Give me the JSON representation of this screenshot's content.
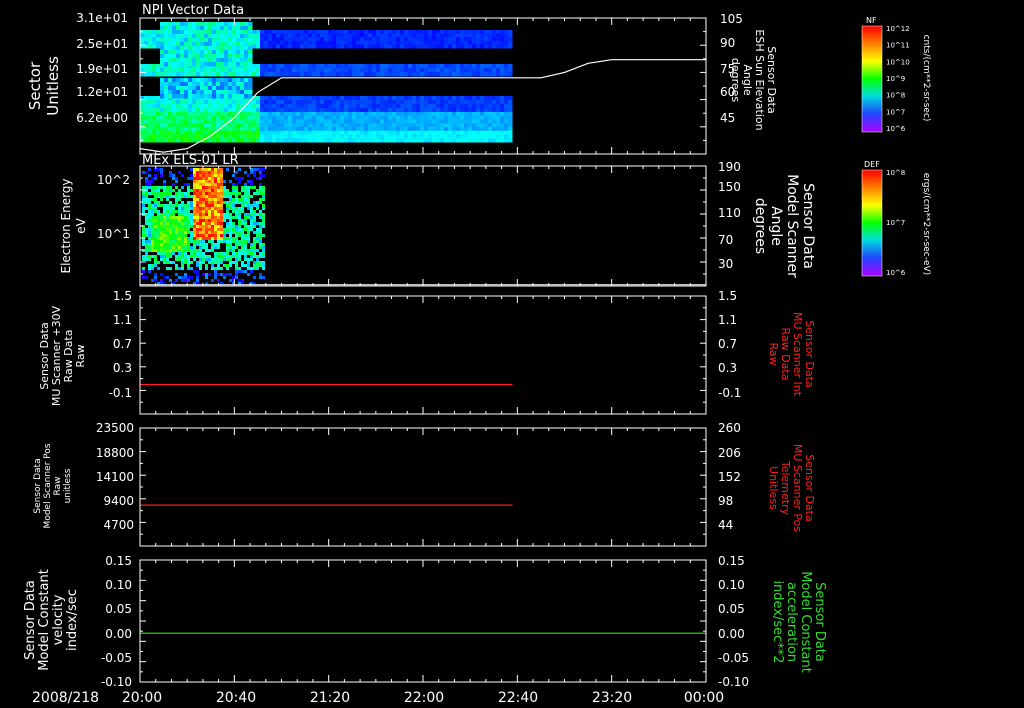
{
  "time_axis": {
    "date_label": "2008/218",
    "ticks": [
      "20:00",
      "20:40",
      "21:20",
      "22:00",
      "22:40",
      "23:20",
      "00:00"
    ],
    "range_hours": [
      20,
      24
    ]
  },
  "colors": {
    "background": "#000000",
    "axis": "#ffffff",
    "red_series": "#ff2020",
    "green_series": "#33dd33"
  },
  "chart_data": [
    {
      "type": "heatmap",
      "title": "NPI Vector Data",
      "ylabel_left": [
        "Sector",
        "Unitless"
      ],
      "yticks_left": [
        "3.1e+01",
        "2.5e+01",
        "1.9e+01",
        "1.2e+01",
        "6.2e+00"
      ],
      "ylabel_right": [
        "Sensor Data",
        "ESH Sun Elevation",
        "Angle",
        "degrees"
      ],
      "yticks_right": [
        "105",
        "90",
        "75",
        "60",
        "45"
      ],
      "ylim_right": [
        30,
        105
      ],
      "data_end_time": "22:37",
      "overlay_line": {
        "name": "ESH Sun Elevation Angle",
        "x": [
          "20:00",
          "20:10",
          "20:20",
          "20:30",
          "20:40",
          "20:50",
          "21:00",
          "22:40",
          "22:50",
          "23:00",
          "23:10",
          "23:20",
          "00:00"
        ],
        "y": [
          33,
          31,
          33,
          40,
          50,
          64,
          72,
          72,
          72,
          75,
          80,
          82,
          82
        ]
      },
      "colorbar": {
        "label": "NF",
        "ticks": [
          "10^12",
          "10^11",
          "10^10",
          "10^9",
          "10^8",
          "10^7",
          "10^6"
        ],
        "units": "cnts/(cm**2-sr-sec)"
      }
    },
    {
      "type": "heatmap",
      "title": "MEx ELS-01 LR",
      "ylabel_left": [
        "Electron Energy",
        "eV"
      ],
      "yticks_left": [
        "10^2",
        "10^1"
      ],
      "yscale": "log",
      "ylabel_right": [
        "Sensor Data",
        "Model Scanner",
        "Angle",
        "degrees"
      ],
      "yticks_right": [
        "190",
        "150",
        "110",
        "70",
        "30"
      ],
      "ylim_right": [
        10,
        190
      ],
      "data_end_time": "20:53",
      "overlay_line": {
        "name": "Model Scanner Angle",
        "x": [
          "20:00",
          "00:00"
        ],
        "y": [
          12,
          12
        ]
      },
      "colorbar": {
        "label": "DEF",
        "ticks": [
          "10^8",
          "10^7",
          "10^6"
        ],
        "units": "ergs/(cm**2-sr-sec-eV)"
      }
    },
    {
      "type": "line",
      "ylabel_left": [
        "Sensor Data",
        "MU Scanner +30V",
        "Raw Data",
        "Raw"
      ],
      "yticks_left": [
        "1.5",
        "1.1",
        "0.7",
        "0.3",
        "-0.1"
      ],
      "ylim_left": [
        -0.5,
        1.5
      ],
      "ylabel_right": [
        "Sensor Data",
        "MU Scanner Int",
        "Raw Data",
        "Raw"
      ],
      "yticks_right": [
        "1.5",
        "1.1",
        "0.7",
        "0.3",
        "-0.1"
      ],
      "series": [
        {
          "name": "MU Scanner Int Raw Data",
          "color": "#ff2020",
          "x": [
            "20:00",
            "22:38"
          ],
          "y": [
            0.0,
            0.0
          ]
        }
      ]
    },
    {
      "type": "line",
      "ylabel_left": [
        "Sensor Data",
        "Model Scanner Pos",
        "Raw",
        "unitless"
      ],
      "yticks_left": [
        "23500",
        "18800",
        "14100",
        "9400",
        "4700"
      ],
      "ylim_left": [
        0,
        23500
      ],
      "ylabel_right": [
        "Sensor Data",
        "MU Scanner Pos",
        "Telemetry",
        "Unitless"
      ],
      "yticks_right": [
        "260",
        "206",
        "152",
        "98",
        "44"
      ],
      "ylim_right": [
        0,
        260
      ],
      "series": [
        {
          "name": "MU Scanner Pos Telemetry",
          "color": "#ff2020",
          "x": [
            "20:00",
            "22:38"
          ],
          "y_right": [
            90,
            90
          ]
        }
      ]
    },
    {
      "type": "line",
      "ylabel_left": [
        "Sensor Data",
        "Model Constant",
        "velocity",
        "index/sec"
      ],
      "yticks_left": [
        "0.15",
        "0.10",
        "0.05",
        "0.00",
        "-0.05",
        "-0.10"
      ],
      "ylim_left": [
        -0.1,
        0.15
      ],
      "ylabel_right": [
        "Sensor Data",
        "Model Constant",
        "acceleration",
        "index/sec**2"
      ],
      "yticks_right": [
        "0.15",
        "0.10",
        "0.05",
        "0.00",
        "-0.05",
        "-0.10"
      ],
      "series": [
        {
          "name": "Model Constant acceleration",
          "color": "#33dd33",
          "x": [
            "20:00",
            "00:00"
          ],
          "y": [
            0.0,
            0.0
          ]
        }
      ]
    }
  ]
}
